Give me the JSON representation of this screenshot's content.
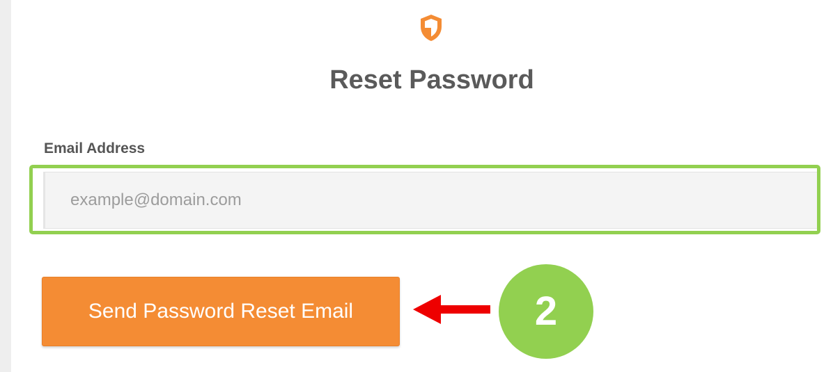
{
  "page": {
    "title": "Reset Password"
  },
  "form": {
    "email_label": "Email Address",
    "email_placeholder": "example@domain.com",
    "email_value": "",
    "submit_label": "Send Password Reset Email"
  },
  "annotations": {
    "step_number": "2",
    "highlight_color": "#92d050",
    "arrow_color": "#ee0000"
  },
  "icons": {
    "header_icon": "shield-icon"
  },
  "colors": {
    "accent": "#f48c34",
    "title_text": "#5a5a5a",
    "input_background": "#f4f4f4"
  }
}
